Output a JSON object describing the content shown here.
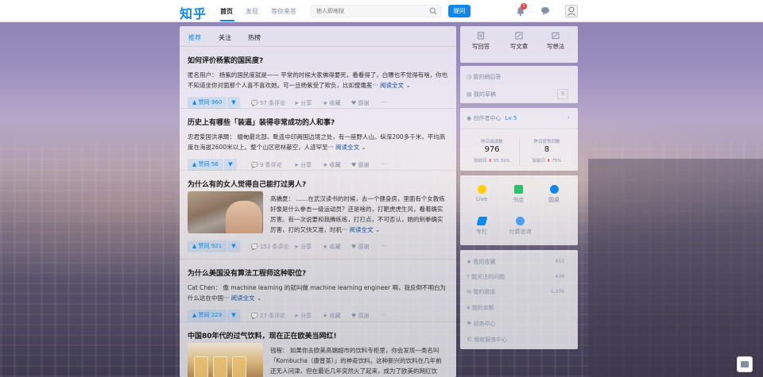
{
  "app": {
    "logo": "知乎"
  },
  "nav": {
    "items": [
      {
        "label": "首页"
      },
      {
        "label": "发现"
      },
      {
        "label": "等你来答"
      }
    ],
    "search_placeholder": "他人即地狱",
    "ask_label": "提问",
    "notification_count": "1"
  },
  "feed": {
    "tabs": [
      {
        "label": "推荐"
      },
      {
        "label": "关注"
      },
      {
        "label": "热榜"
      }
    ],
    "cards": [
      {
        "title": "如何评价杨紫的国民度?",
        "excerpt": "匿名用户：  杨紫的国民度就是—— 平常的时候大家佛得要死，看看得了，白瞟也不觉得有啥，你也不知道坐你对面那个人喜不喜欢她。可一旦杨紫受了欺负，比如傻鹰冕···",
        "read_more": "阅读全文",
        "vote": "赞同 960",
        "comments": "57 条评论",
        "share": "分享",
        "favorite": "收藏",
        "thanks": "感谢",
        "more": "···"
      },
      {
        "title": "历史上有哪些「装逼」装得非常成功的人和事?",
        "excerpt": "忠君爱国洪承畴：  缅甸最北部、毗连中印两国边境之处，有一座野人山。纵深200多千米，平均高度在海拔2600米以上。整个山区密林蔽空，人迹罕至···",
        "read_more": "阅读全文",
        "vote": "赞同 56",
        "comments": "9 条评论",
        "share": "分享",
        "favorite": "收藏",
        "thanks": "感谢",
        "more": "···"
      },
      {
        "title": "为什么有的女人觉得自己能打过男人?",
        "excerpt": "高橋夏：  ……在武汉读书的时候，去一个健身房，里面有个女教练好像是什么拳击一级运动员？还是啥的，打靶虎虎生风，看着确实厉害。有一次说要和我腾练练，打打点，不可否认，她的刺拳确实厉害，打的又快又准，时机···",
        "read_more": "阅读全文",
        "vote": "赞同 921",
        "comments": "152 条评论",
        "share": "分享",
        "favorite": "收藏",
        "thanks": "感谢",
        "more": "···"
      },
      {
        "title": "为什么美国没有算法工程师这种职位?",
        "excerpt": "Cat Chen：  像 machine learning 的就叫做 machine learning engineer 啊，我反倒不明白为什么这在中国···",
        "read_more": "阅读全文",
        "vote": "赞同 229",
        "comments": "27 条评论",
        "share": "分享",
        "favorite": "收藏",
        "thanks": "感谢",
        "more": "···"
      },
      {
        "title": "中国80年代的过气饮料，现在正在欧美当网红!",
        "excerpt_line1": "钱程：  如果你去欧美高端超市的饮料专柜里，你会发现一类名叫",
        "excerpt_line2": "「Kombucha（康普茶）」的神奇饮料。这种新兴的饮料在几年前",
        "excerpt_line3": "还无人问津，但在最近几年突然火了起来，成为了欧美的网红饮"
      }
    ]
  },
  "sidebar": {
    "write": [
      {
        "label": "写回答"
      },
      {
        "label": "写文章"
      },
      {
        "label": "写想法"
      }
    ],
    "drafts": [
      {
        "label": "我的稍后答"
      },
      {
        "label": "我的草稿",
        "count": "5"
      }
    ],
    "creator": {
      "label": "创作者中心",
      "level": "Lv 5",
      "stats": [
        {
          "label": "昨日阅读数",
          "value": "976",
          "compare": "较前日",
          "change": "55.33%"
        },
        {
          "label": "昨日获赞同数",
          "value": "8",
          "compare": "较前日",
          "change": "75%"
        }
      ]
    },
    "grid": [
      {
        "label": "Live"
      },
      {
        "label": "书店"
      },
      {
        "label": "圆桌"
      },
      {
        "label": "专栏"
      },
      {
        "label": "付费咨询"
      }
    ],
    "links": [
      {
        "label": "我的收藏",
        "count": "453"
      },
      {
        "label": "我关注的问题",
        "count": "439"
      },
      {
        "label": "我的邀请",
        "count": "1,376"
      },
      {
        "label": "我的余额"
      },
      {
        "label": "站务中心"
      },
      {
        "label": "版权服务中心"
      }
    ]
  }
}
